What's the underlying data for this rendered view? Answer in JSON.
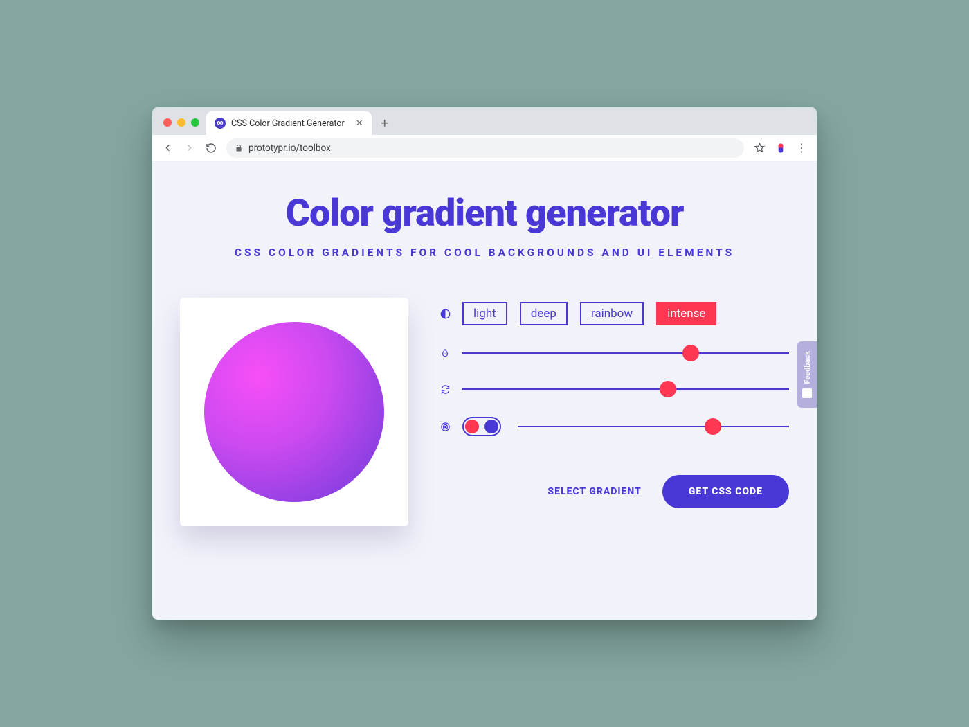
{
  "browser": {
    "tab_title": "CSS Color Gradient Generator",
    "url": "prototypr.io/toolbox"
  },
  "page": {
    "heading": "Color gradient generator",
    "subheading": "CSS color gradients for cool backgrounds and UI elements"
  },
  "presets": {
    "items": [
      "light",
      "deep",
      "rainbow",
      "intense"
    ],
    "active": "intense"
  },
  "sliders": {
    "hue_pct": 70,
    "rotation_pct": 63,
    "mix_pct": 72
  },
  "actions": {
    "select_gradient_label": "SELECT GRADIENT",
    "get_css_label": "GET CSS CODE"
  },
  "feedback": {
    "label": "Feedback"
  },
  "colors": {
    "brand": "#4938d6",
    "accent": "#ff3753",
    "orb_start": "#f84ef8",
    "orb_end": "#6a37d0"
  }
}
